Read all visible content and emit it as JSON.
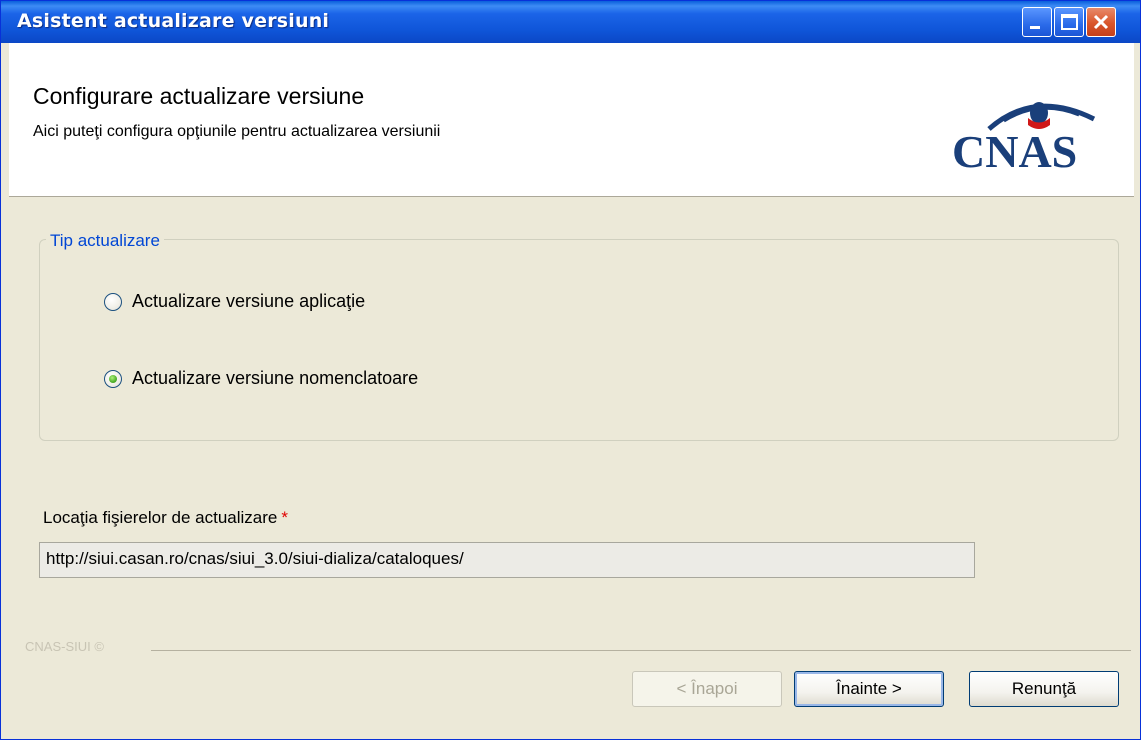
{
  "window": {
    "title": "Asistent actualizare versiuni"
  },
  "header": {
    "title": "Configurare actualizare versiune",
    "subtitle": "Aici puteţi configura opţiunile pentru actualizarea versiunii",
    "logo_text": "CNAS"
  },
  "update_type": {
    "legend": "Tip actualizare",
    "options": [
      {
        "label": "Actualizare versiune aplicaţie",
        "selected": false
      },
      {
        "label": "Actualizare versiune nomenclatoare",
        "selected": true
      }
    ]
  },
  "location": {
    "label": "Locaţia fişierelor de actualizare",
    "required_marker": "*",
    "value": "http://siui.casan.ro/cnas/siui_3.0/siui-dializa/cataloques/"
  },
  "footer": {
    "mark": "CNAS-SIUI ©"
  },
  "buttons": {
    "back": "< Înapoi",
    "next": "Înainte >",
    "cancel": "Renunţă"
  },
  "colors": {
    "titlebar": "#0b55d8",
    "legend": "#0046d5",
    "required": "#e00000",
    "logo": "#1a3f7a"
  }
}
